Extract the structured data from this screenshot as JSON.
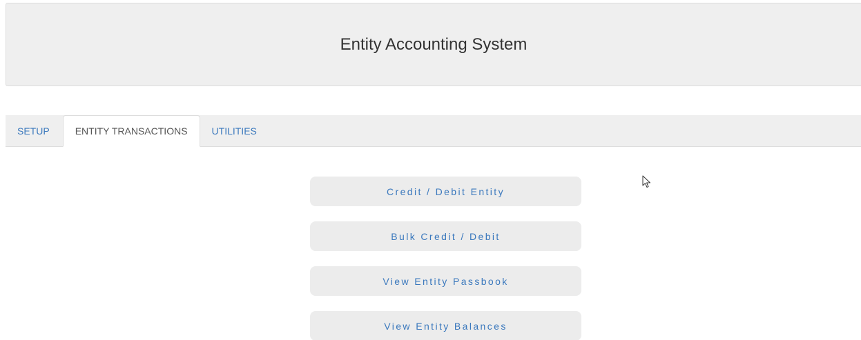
{
  "header": {
    "title": "Entity Accounting System"
  },
  "tabs": [
    {
      "label": "SETUP",
      "active": false
    },
    {
      "label": "ENTITY TRANSACTIONS",
      "active": true
    },
    {
      "label": "UTILITIES",
      "active": false
    }
  ],
  "actions": [
    {
      "label": "Credit / Debit Entity"
    },
    {
      "label": "Bulk Credit / Debit"
    },
    {
      "label": "View Entity Passbook"
    },
    {
      "label": "View Entity Balances"
    }
  ],
  "colors": {
    "link": "#3a78bd",
    "panel": "#efefef",
    "button": "#ececec",
    "title": "#333333"
  },
  "icons": {
    "cursor": "mouse-pointer-icon"
  }
}
